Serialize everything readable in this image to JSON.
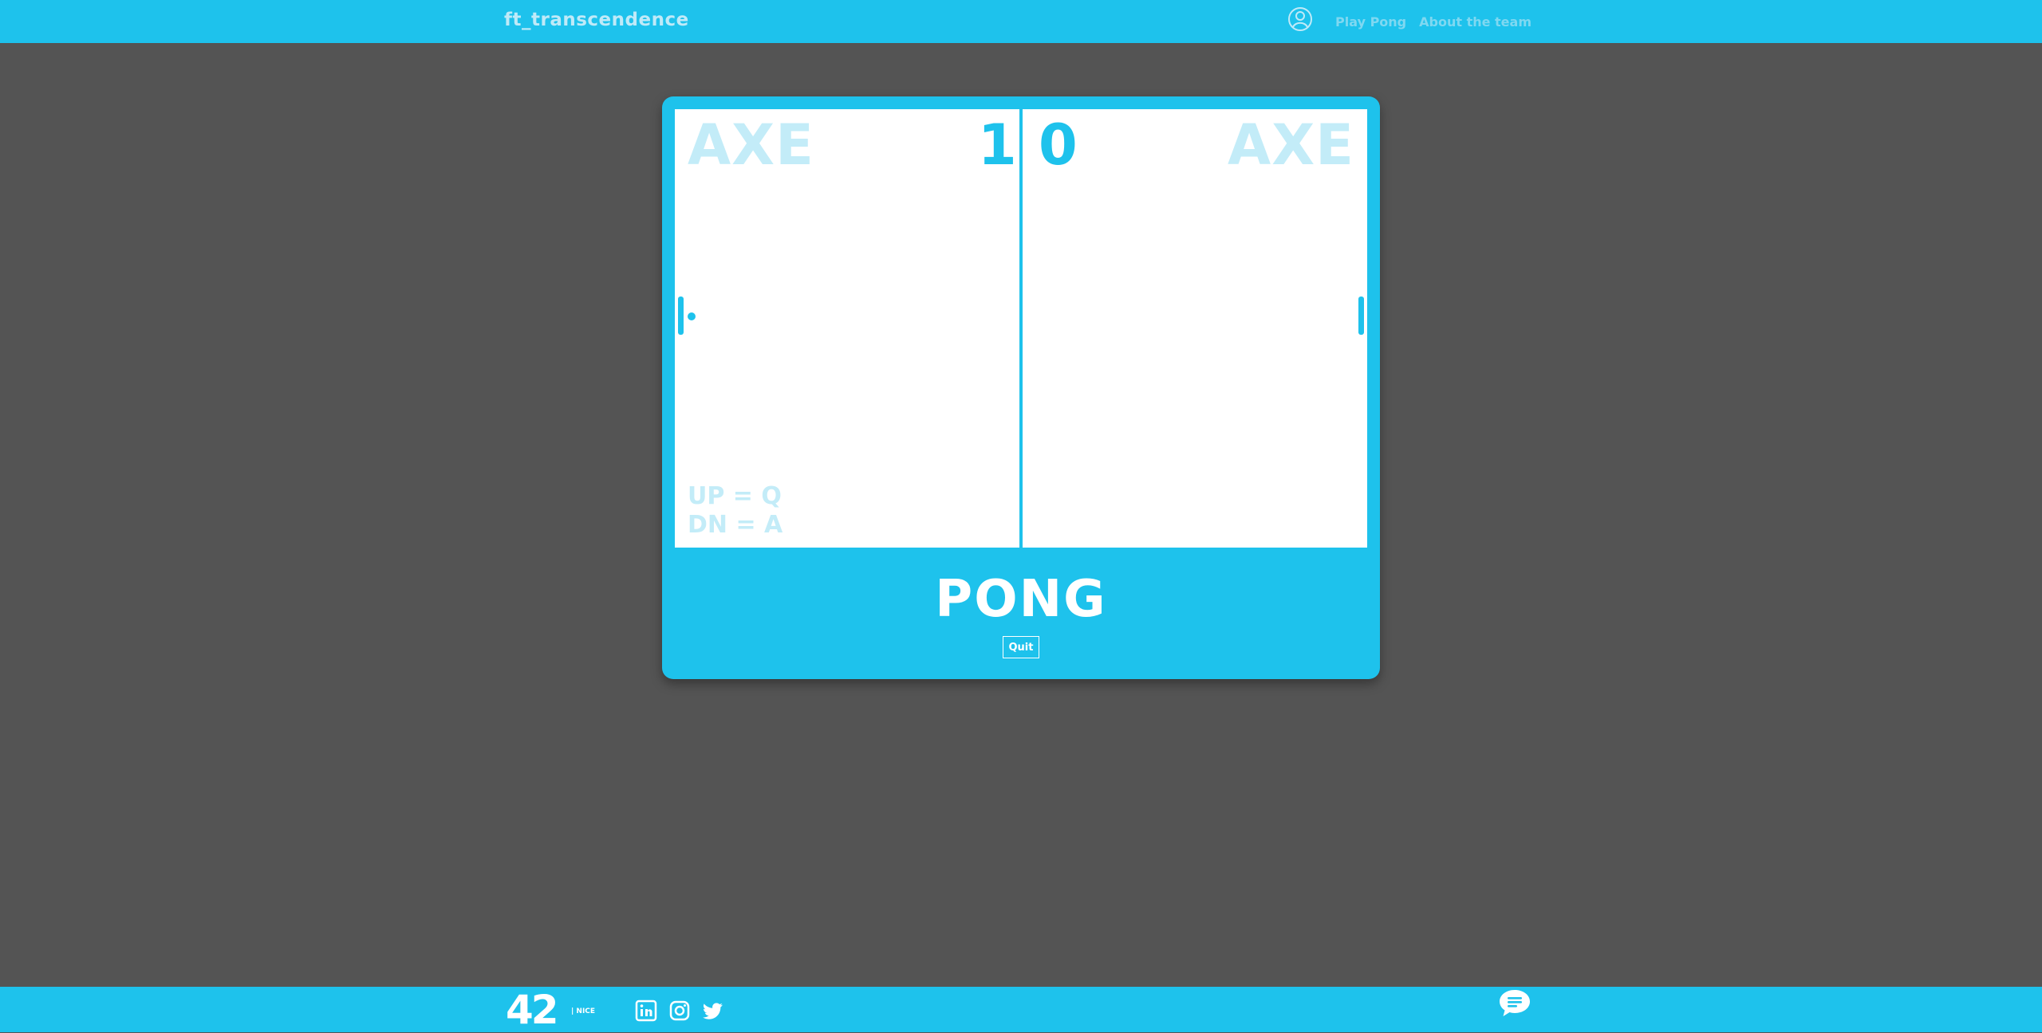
{
  "header": {
    "brand": "ft_transcendence",
    "nav": [
      {
        "label": "Play Pong"
      },
      {
        "label": "About the team"
      }
    ],
    "icons": {
      "user": "user-circle-icon"
    }
  },
  "game": {
    "title": "PONG",
    "left_player": {
      "name": "AXE",
      "score": "1"
    },
    "right_player": {
      "name": "AXE",
      "score": "0"
    },
    "controls": {
      "up": "UP = Q",
      "down": "DN = A"
    },
    "quit_label": "Quit"
  },
  "footer": {
    "logo_main": "42",
    "logo_sub": "| NICE",
    "social_icons": [
      "linkedin-icon",
      "instagram-icon",
      "twitter-icon"
    ],
    "chat_icon": "chat-icon"
  },
  "colors": {
    "accent": "#1ec2ec",
    "background": "#545454",
    "court": "#ffffff",
    "faded_text": "#c3ecf8"
  }
}
